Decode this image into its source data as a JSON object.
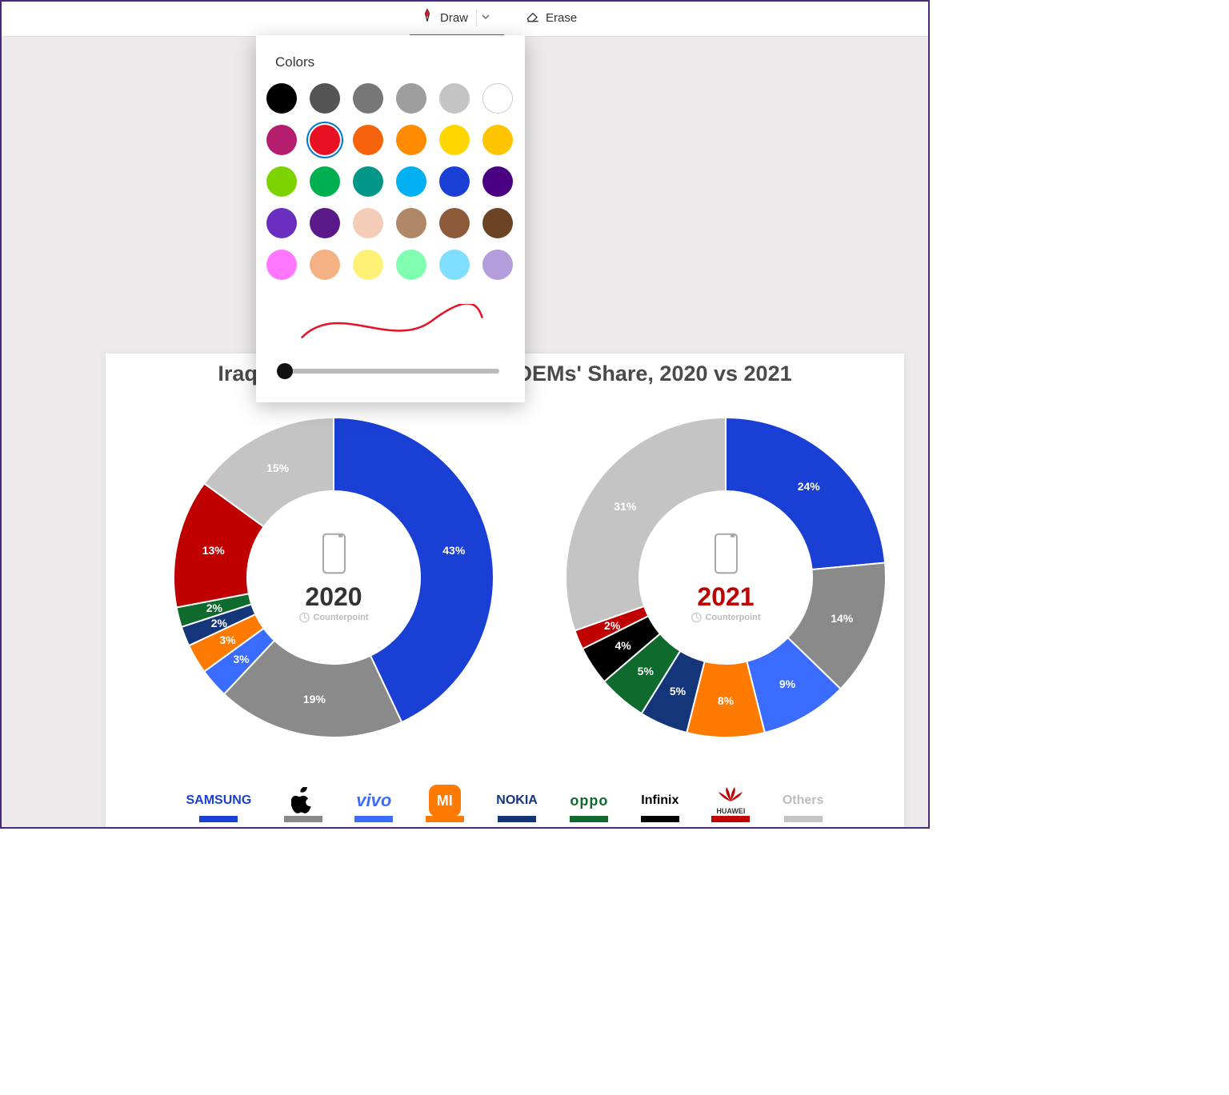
{
  "toolbar": {
    "draw_label": "Draw",
    "erase_label": "Erase"
  },
  "picker": {
    "title": "Colors",
    "selected_index": 7,
    "thickness": 2,
    "swatches": [
      "#000000",
      "#555555",
      "#777777",
      "#9e9e9e",
      "#c4c4c4",
      "#ffffff",
      "#b51e6e",
      "#e81123",
      "#f7630c",
      "#ff8c00",
      "#ffd600",
      "#ffc400",
      "#7cd300",
      "#00b050",
      "#009688",
      "#00b0f0",
      "#1a3fd4",
      "#4b0082",
      "#6b2fbf",
      "#5a1a8a",
      "#f3cdb8",
      "#b08868",
      "#8d5a3a",
      "#6b4423",
      "#ff77ff",
      "#f4b183",
      "#fff176",
      "#80ffb0",
      "#80dfff",
      "#b39ddb"
    ],
    "preview_color": "#e81123"
  },
  "chart_data": [
    {
      "type": "donut",
      "year": "2020",
      "year_color": "#222",
      "source": "Counterpoint",
      "series": [
        {
          "name": "Samsung",
          "value": 43,
          "color": "#1a3fd4"
        },
        {
          "name": "Apple",
          "value": 19,
          "color": "#8a8a8a"
        },
        {
          "name": "vivo",
          "value": 3,
          "color": "#3a6cff"
        },
        {
          "name": "Xiaomi",
          "value": 3,
          "color": "#ff7a00"
        },
        {
          "name": "Nokia",
          "value": 2,
          "color": "#14357a"
        },
        {
          "name": "OPPO",
          "value": 2,
          "color": "#0e6b2d"
        },
        {
          "name": "Infinix",
          "value": 0,
          "color": "#000000"
        },
        {
          "name": "Huawei",
          "value": 13,
          "color": "#c00000"
        },
        {
          "name": "Others",
          "value": 15,
          "color": "#c4c4c4"
        }
      ]
    },
    {
      "type": "donut",
      "year": "2021",
      "year_color": "#c00000",
      "source": "Counterpoint",
      "series": [
        {
          "name": "Samsung",
          "value": 24,
          "color": "#1a3fd4"
        },
        {
          "name": "Apple",
          "value": 14,
          "color": "#8a8a8a"
        },
        {
          "name": "vivo",
          "value": 9,
          "color": "#3a6cff"
        },
        {
          "name": "Xiaomi",
          "value": 8,
          "color": "#ff7a00"
        },
        {
          "name": "Nokia",
          "value": 5,
          "color": "#14357a"
        },
        {
          "name": "OPPO",
          "value": 5,
          "color": "#0e6b2d"
        },
        {
          "name": "Infinix",
          "value": 4,
          "color": "#000000"
        },
        {
          "name": "Huawei",
          "value": 2,
          "color": "#c00000"
        },
        {
          "name": "Others",
          "value": 31,
          "color": "#c4c4c4"
        }
      ]
    }
  ],
  "chart_meta": {
    "title": "Iraq Smartphone Market Top OEMs' Share, 2020 vs 2021",
    "legend": [
      {
        "name": "SAMSUNG",
        "logo": "SAMSUNG",
        "logo_color": "#1a3fd4",
        "bar": "#1a3fd4",
        "style": "text"
      },
      {
        "name": "Apple",
        "logo": "apple",
        "logo_color": "#000",
        "bar": "#8a8a8a",
        "style": "apple"
      },
      {
        "name": "vivo",
        "logo": "vivo",
        "logo_color": "#3a6cff",
        "bar": "#3a6cff",
        "style": "text-italic"
      },
      {
        "name": "Xiaomi",
        "logo": "mi",
        "logo_color": "#fff",
        "bar": "#ff7a00",
        "style": "mi"
      },
      {
        "name": "NOKIA",
        "logo": "NOKIA",
        "logo_color": "#14357a",
        "bar": "#14357a",
        "style": "text"
      },
      {
        "name": "OPPO",
        "logo": "oppo",
        "logo_color": "#0e6b2d",
        "bar": "#0e6b2d",
        "style": "oppo"
      },
      {
        "name": "Infinix",
        "logo": "Infinix",
        "logo_color": "#000",
        "bar": "#000",
        "style": "text"
      },
      {
        "name": "HUAWEI",
        "logo": "HUAWEI",
        "logo_color": "#c00000",
        "bar": "#c00000",
        "style": "huawei"
      },
      {
        "name": "Others",
        "logo": "Others",
        "logo_color": "#bdbdbd",
        "bar": "#c4c4c4",
        "style": "text"
      }
    ]
  }
}
